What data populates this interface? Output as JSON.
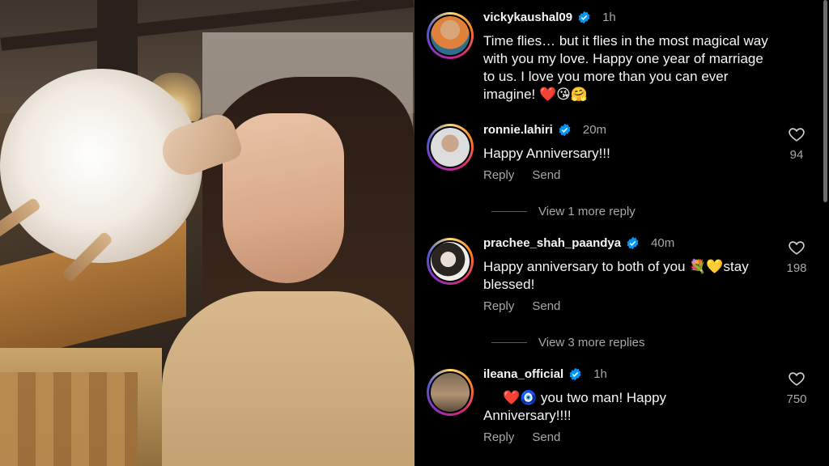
{
  "post": {
    "username": "vickykaushal09",
    "time": "1h",
    "caption_line1": "Time flies… but it flies in the most magical way",
    "caption_line2": "with you my love. Happy one year of marriage",
    "caption_line3": "to us. I love you more than you can ever",
    "caption_line4": "imagine! ❤️😘🤗"
  },
  "comments": [
    {
      "username": "ronnie.lahiri",
      "time": "20m",
      "text_line1": "Happy Anniversary!!!",
      "text_line2": "",
      "likes": "94",
      "reply_label": "Reply",
      "send_label": "Send",
      "more_replies": "View 1 more reply"
    },
    {
      "username": "prachee_shah_paandya",
      "time": "40m",
      "text_line1": "Happy anniversary to both of you 💐💛stay",
      "text_line2": "blessed!",
      "likes": "198",
      "reply_label": "Reply",
      "send_label": "Send",
      "more_replies": "View 3 more replies"
    },
    {
      "username": "ileana_official",
      "time": "1h",
      "text_line1": "❤️🧿 you two man! Happy",
      "text_line2": "Anniversary!!!!",
      "likes": "750",
      "reply_label": "Reply",
      "send_label": "Send",
      "more_replies": ""
    }
  ],
  "colors": {
    "background": "#000000",
    "text_primary": "#f5f5f5",
    "text_secondary": "#a8a8a8",
    "verified_blue": "#0095f6"
  }
}
